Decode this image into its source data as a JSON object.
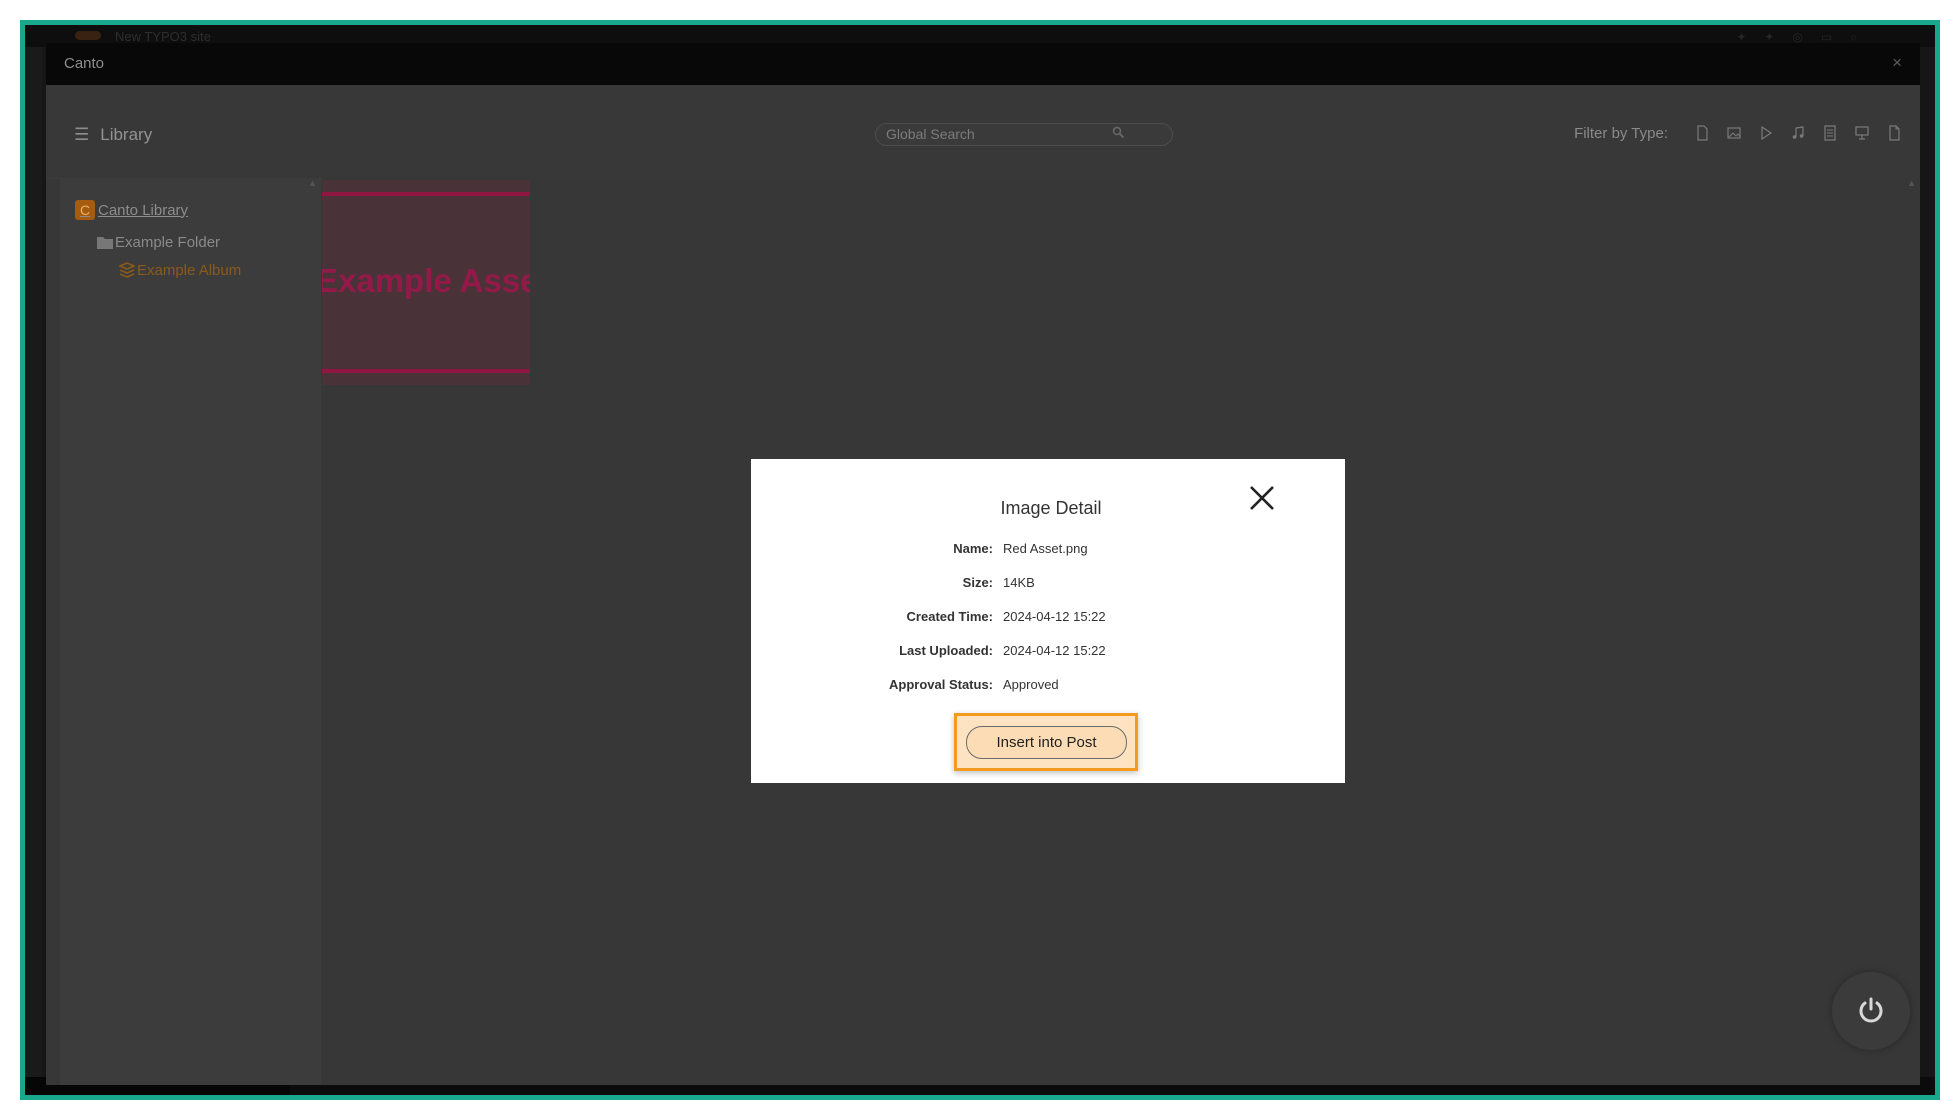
{
  "background": {
    "site_title": "New TYPO3 site"
  },
  "modal": {
    "title": "Canto",
    "close_glyph": "×",
    "library_label": "Library",
    "search_placeholder": "Global Search",
    "filter_label": "Filter by Type:",
    "filter_icons": [
      "document-icon",
      "image-icon",
      "video-icon",
      "audio-icon",
      "text-document-icon",
      "presentation-icon",
      "file-icon"
    ]
  },
  "tree": {
    "root": "Canto Library",
    "folder": "Example Folder",
    "album": "Example Album"
  },
  "thumbnail": {
    "text": "Example Asset"
  },
  "dialog": {
    "title": "Image Detail",
    "fields": [
      {
        "label": "Name:",
        "value": "Red Asset.png"
      },
      {
        "label": "Size:",
        "value": "14KB"
      },
      {
        "label": "Created Time:",
        "value": "2024-04-12 15:22"
      },
      {
        "label": "Last Uploaded:",
        "value": "2024-04-12 15:22"
      },
      {
        "label": "Approval Status:",
        "value": "Approved"
      }
    ],
    "insert_label": "Insert into Post"
  },
  "colors": {
    "frame_border": "#1aa88c",
    "highlight": "#f39b1e",
    "thumb_accent": "#931a48"
  }
}
